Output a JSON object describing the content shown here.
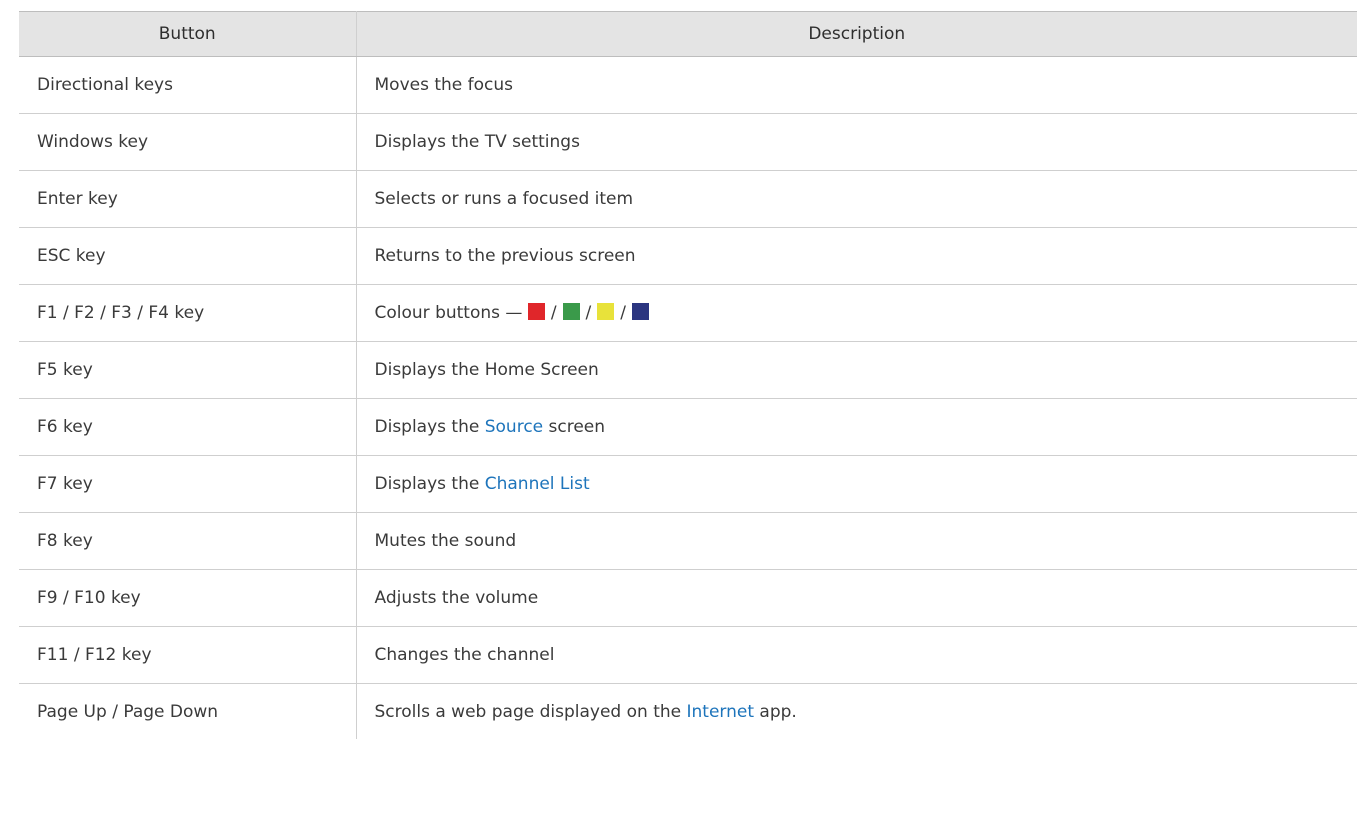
{
  "table": {
    "headers": [
      "Button",
      "Description"
    ],
    "rows": [
      {
        "key": "Directional keys",
        "desc_pre": "Moves the focus"
      },
      {
        "key": "Windows key",
        "desc_pre": "Displays the TV settings"
      },
      {
        "key": "Enter key",
        "desc_pre": "Selects or runs a focused item"
      },
      {
        "key": "ESC key",
        "desc_pre": "Returns to the previous screen"
      },
      {
        "key": "F1 / F2 / F3 / F4 key",
        "desc_pre": "Colour buttons —"
      },
      {
        "key": "F5 key",
        "desc_pre": "Displays the Home Screen"
      },
      {
        "key": "F6 key",
        "desc_pre": "Displays the ",
        "desc_link": "Source",
        "desc_post": " screen"
      },
      {
        "key": "F7 key",
        "desc_pre": "Displays the ",
        "desc_link": "Channel List"
      },
      {
        "key": "F8 key",
        "desc_pre": "Mutes the sound"
      },
      {
        "key": "F9 / F10 key",
        "desc_pre": "Adjusts the volume"
      },
      {
        "key": "F11 / F12 key",
        "desc_pre": "Changes the channel"
      },
      {
        "key": "Page Up / Page Down",
        "desc_pre": "Scrolls a web page displayed on the ",
        "desc_link": "Internet",
        "desc_post": " app."
      }
    ]
  },
  "colour_buttons": {
    "separator": "/",
    "colors": [
      "#e0262a",
      "#3a9a4a",
      "#e8e23a",
      "#2b3580"
    ]
  },
  "colors": {
    "header_bg": "#e4e4e4",
    "link": "#1d74bb",
    "text": "#3a3a3a"
  }
}
